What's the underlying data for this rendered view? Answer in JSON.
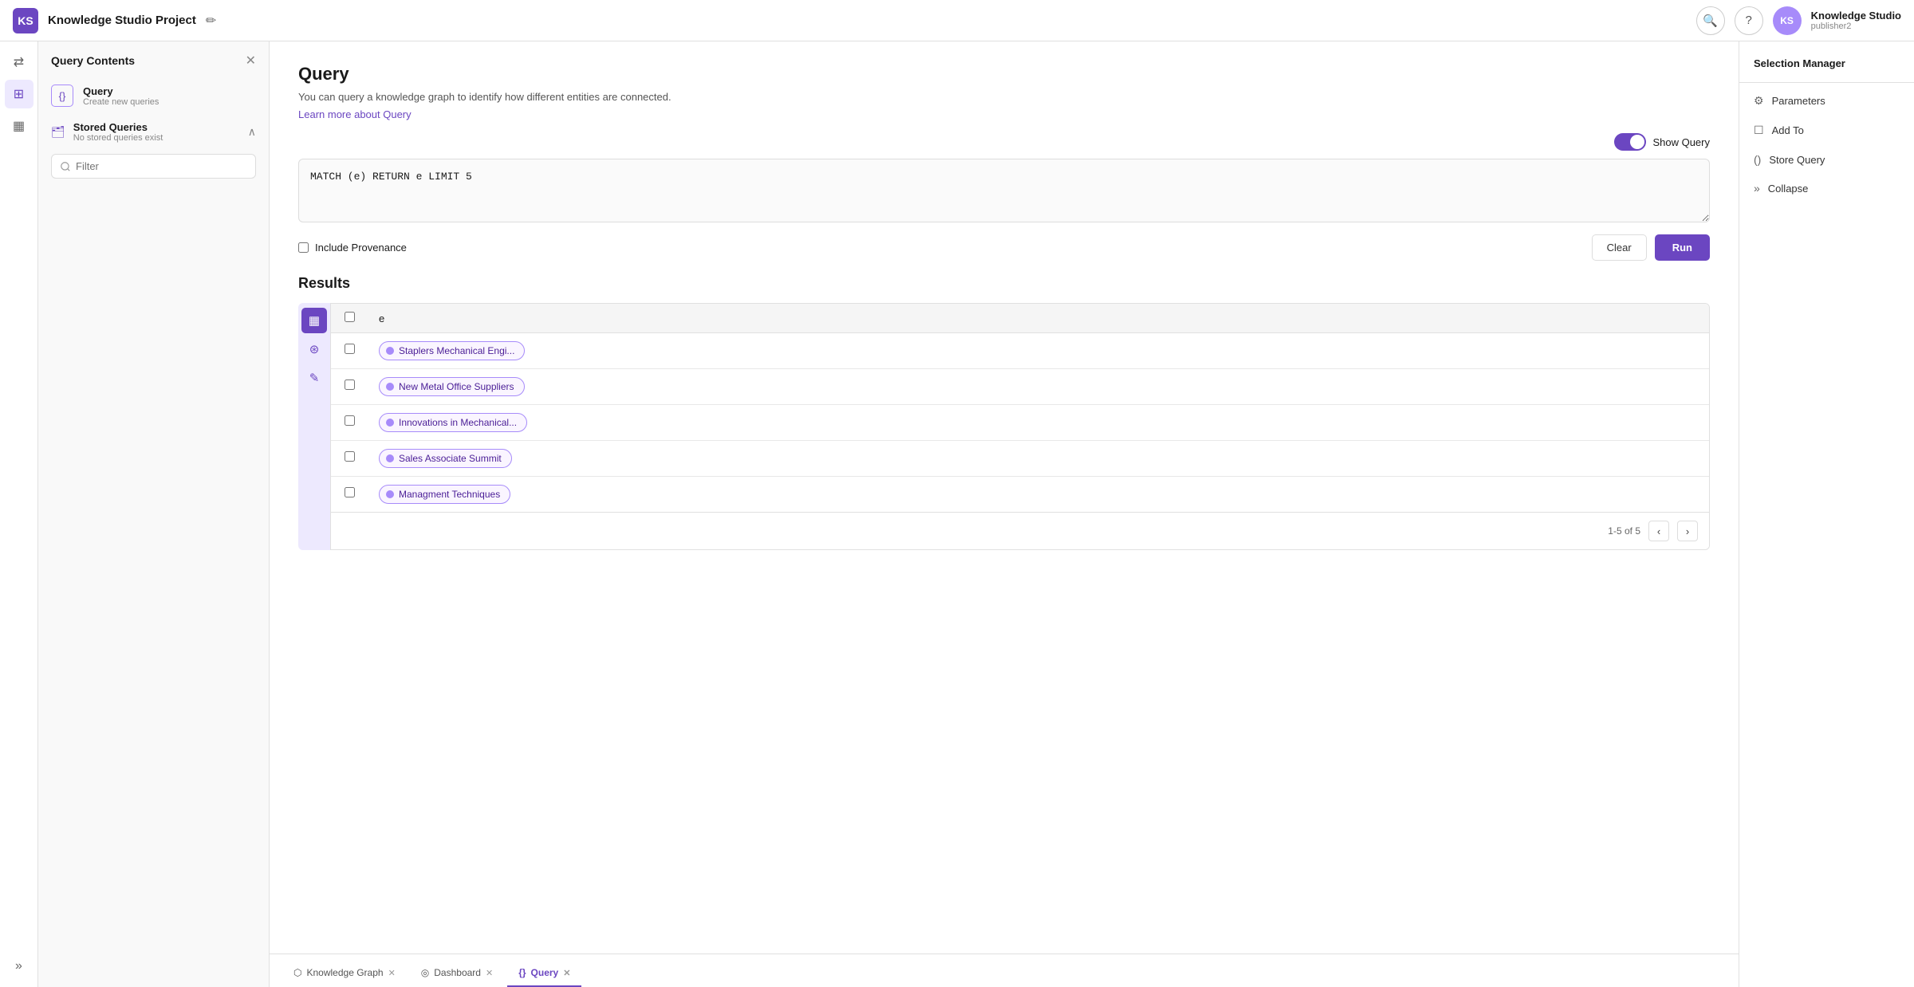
{
  "app": {
    "logo": "KS",
    "title": "Knowledge Studio Project",
    "user_initials": "KS",
    "user_name": "Knowledge Studio",
    "user_sub": "publisher2"
  },
  "left_panel": {
    "title": "Query Contents",
    "query_item": {
      "title": "Query",
      "subtitle": "Create new queries"
    },
    "stored_queries": {
      "title": "Stored Queries",
      "subtitle": "No stored queries exist",
      "filter_placeholder": "Filter"
    }
  },
  "main": {
    "page_title": "Query",
    "page_subtitle": "You can query a knowledge graph to identify how different entities are connected.",
    "learn_link": "Learn more about Query",
    "show_query_label": "Show Query",
    "query_text": "MATCH (e) RETURN e LIMIT 5",
    "include_provenance_label": "Include Provenance",
    "btn_clear": "Clear",
    "btn_run": "Run",
    "results_title": "Results",
    "table_header": "e",
    "results": [
      {
        "label": "Staplers Mechanical Engi..."
      },
      {
        "label": "New Metal Office Suppliers"
      },
      {
        "label": "Innovations in Mechanical..."
      },
      {
        "label": "Sales Associate Summit"
      },
      {
        "label": "Managment Techniques"
      }
    ],
    "pagination": "1-5 of 5"
  },
  "bottom_tabs": [
    {
      "id": "knowledge-graph",
      "icon": "⬡",
      "label": "Knowledge Graph",
      "active": false,
      "closable": true
    },
    {
      "id": "dashboard",
      "icon": "◎",
      "label": "Dashboard",
      "active": false,
      "closable": true
    },
    {
      "id": "query",
      "icon": "{}",
      "label": "Query",
      "active": true,
      "closable": true
    }
  ],
  "right_panel": {
    "title": "Selection Manager",
    "items": [
      {
        "id": "parameters",
        "icon": "⚙",
        "label": "Parameters"
      },
      {
        "id": "add-to",
        "icon": "☐",
        "label": "Add To"
      },
      {
        "id": "store-query",
        "icon": "()",
        "label": "Store Query"
      },
      {
        "id": "collapse",
        "icon": "»",
        "label": "Collapse"
      }
    ]
  }
}
